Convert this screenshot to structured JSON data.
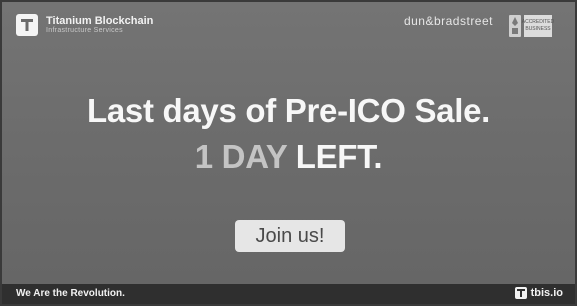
{
  "header": {
    "brand_name": "Titanium Blockchain",
    "brand_subtitle": "Infrastructure Services",
    "partner_name": "dun&bradstreet",
    "partner_subtitle": "",
    "badge_label": "ACCREDITED BUSINESS"
  },
  "hero": {
    "headline": "Last days of Pre-ICO Sale.",
    "countdown_days": "1 DAY",
    "countdown_left": "LEFT.",
    "cta_label": "Join us!"
  },
  "footer": {
    "slogan": "We Are the Revolution.",
    "site": "tbis.io"
  },
  "colors": {
    "banner_bg": "#6e6e6e",
    "headline_text": "#f7f7f7",
    "days_text": "#c4c4c4",
    "cta_bg": "#e6e6e6",
    "footer_bg": "#2f2f2f"
  }
}
